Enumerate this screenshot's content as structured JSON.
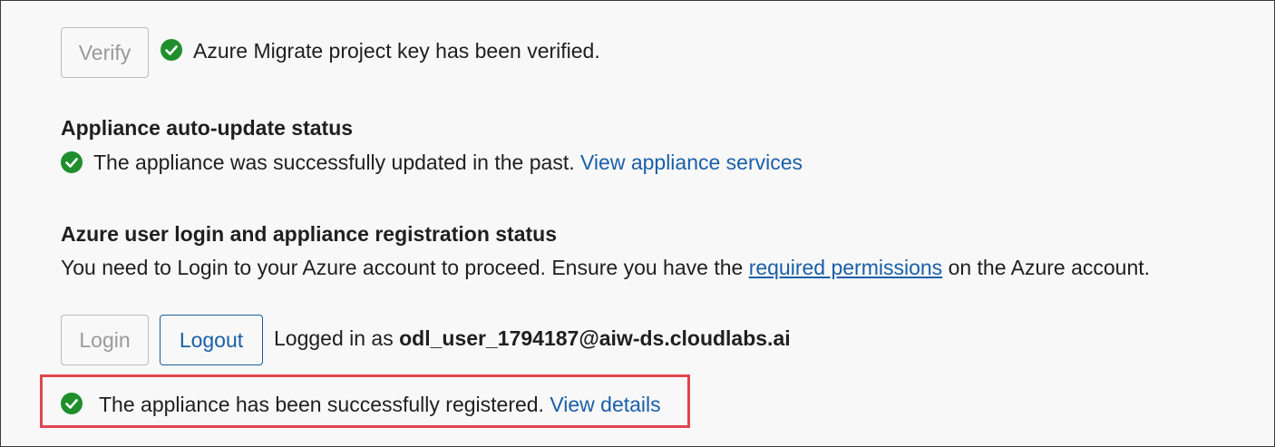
{
  "verify_section": {
    "verify_button_label": "Verify",
    "status_text": "Azure Migrate project key has been verified."
  },
  "auto_update": {
    "heading": "Appliance auto-update status",
    "status_text": "The appliance was successfully updated in the past.",
    "link_label": "View appliance services"
  },
  "registration": {
    "heading": "Azure user login and appliance registration status",
    "instruction_prefix": "You need to Login to your Azure account to proceed. Ensure you have the",
    "permissions_link": "required permissions",
    "instruction_suffix": "on the Azure account.",
    "login_button_label": "Login",
    "logout_button_label": "Logout",
    "logged_in_prefix": "Logged in as",
    "logged_in_user": "odl_user_1794187@aiw-ds.cloudlabs.ai",
    "success_text": "The appliance has been successfully registered.",
    "view_details_link": "View details"
  },
  "colors": {
    "success_green": "#1f8f2c",
    "link_blue": "#1a5fa8",
    "highlight_red": "#e0454f"
  },
  "icons": {
    "status_icon": "success-check-icon"
  }
}
